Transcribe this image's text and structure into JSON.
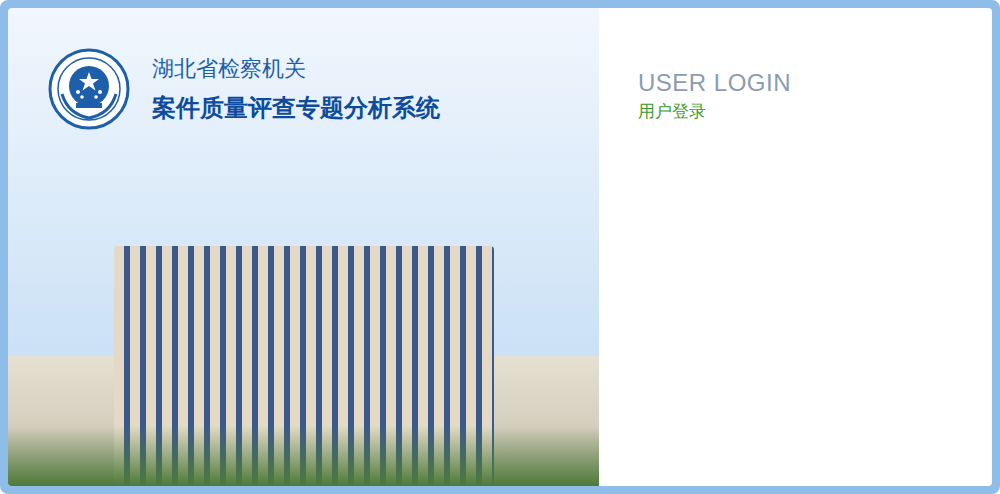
{
  "header": {
    "org": "湖北省检察机关",
    "system": "案件质量评查专题分析系统"
  },
  "login": {
    "title_en": "USER LOGIN",
    "title_cn": "用户登录"
  }
}
